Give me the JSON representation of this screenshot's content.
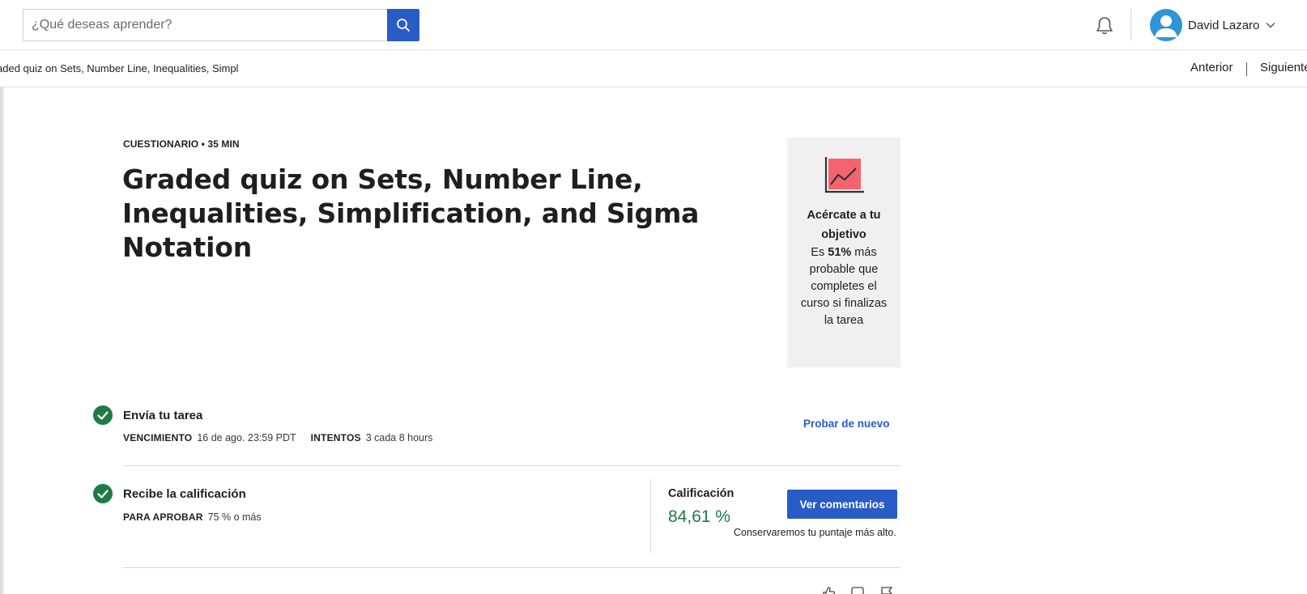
{
  "header": {
    "search_placeholder": "¿Qué deseas aprender?",
    "user_name": "David Lazaro",
    "colors": {
      "brand_blue": "#2a5cc7",
      "avatar_blue": "#2f95d8"
    }
  },
  "nav": {
    "breadcrumb": "aded quiz on Sets, Number Line, Inequalities, Simpl",
    "prev_label": "Anterior",
    "next_label": "Siguiente"
  },
  "main": {
    "eyebrow": "CUESTIONARIO • 35 MIN",
    "title": "Graded quiz on Sets, Number Line, Inequalities, Simplification, and Sigma Notation"
  },
  "goal_card": {
    "title": "Acércate a tu objetivo",
    "text_before": "Es ",
    "percent": "51%",
    "text_after": " más probable que completes el curso si finalizas la tarea",
    "icon": "trend-chart-icon"
  },
  "submit_row": {
    "title": "Envía tu tarea",
    "due_label": "VENCIMIENTO",
    "due_value": "16 de ago. 23:59 PDT",
    "attempts_label": "INTENTOS",
    "attempts_value": "3 cada 8 hours",
    "retry_label": "Probar de nuevo"
  },
  "grade_row": {
    "title": "Recibe la calificación",
    "pass_label": "PARA APROBAR",
    "pass_value": "75 % o más",
    "grade_label": "Calificación",
    "grade_value": "84,61 %",
    "feedback_button": "Ver comentarios",
    "keep_note": "Conservaremos tu puntaje más alto.",
    "grade_color": "#1f7a45"
  }
}
